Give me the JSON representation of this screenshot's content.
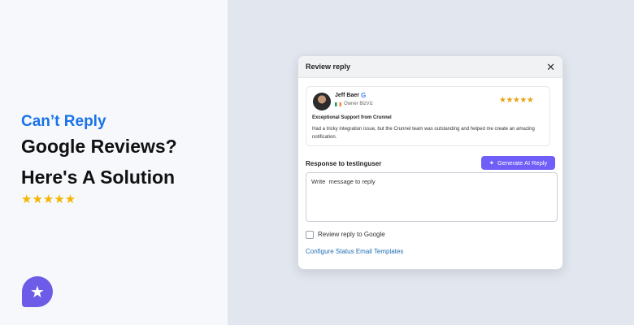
{
  "hero": {
    "line1": "Can’t Reply",
    "line2": "Google Reviews?",
    "line3": "Here's A Solution",
    "stars": "★★★★★"
  },
  "logo": {
    "icon": "star-icon",
    "glyph": "★"
  },
  "modal": {
    "title": "Review reply",
    "close": "✕",
    "review": {
      "reviewer": "Jeff Baer",
      "source_icon": "G",
      "owner": "Owner BizViz",
      "stars": "★★★★★",
      "title": "Exceptional Support from Crunnel",
      "text": "Had a tricky integration issue, but the Crunnel team was outstanding and helped me create an amazing notification."
    },
    "response_label": "Response to testinguser",
    "ai_button": {
      "icon": "✦",
      "label": "Generate AI Reply"
    },
    "textarea_placeholder": "Write  message to reply",
    "checkbox_label": "Review reply to Google",
    "config_link": "Configure Status Email Templates"
  },
  "colors": {
    "accent_blue": "#1a73e8",
    "purple": "#6f5ef7",
    "star": "#f5b400"
  }
}
